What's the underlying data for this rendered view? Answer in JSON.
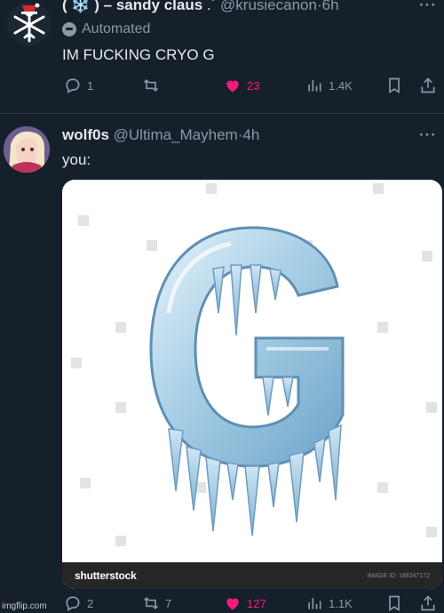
{
  "tweet1": {
    "display_name": "( ❄️ ) – sandy claus",
    "handle": "@krusiecanon",
    "time": "·6h",
    "more": "···",
    "automated_label": "Automated",
    "text": "IM FUCKING CRYO G",
    "actions": {
      "replies": "1",
      "retweets": "",
      "likes": "23",
      "views": "1.4K"
    }
  },
  "tweet2": {
    "display_name": "wolf0s",
    "handle": "@Ultima_Mayhem",
    "time": "·4h",
    "more": "···",
    "text": "you:",
    "media": {
      "watermark_brand": "shutterstock",
      "image_id_text": "IMAGE ID: 188247172"
    },
    "actions": {
      "replies": "2",
      "retweets": "7",
      "likes": "127",
      "views": "1.1K"
    }
  },
  "footer": {
    "watermark": "imgflip.com"
  },
  "colors": {
    "background": "#15202b",
    "like_pink": "#f91880",
    "muted": "#8b98a5"
  }
}
